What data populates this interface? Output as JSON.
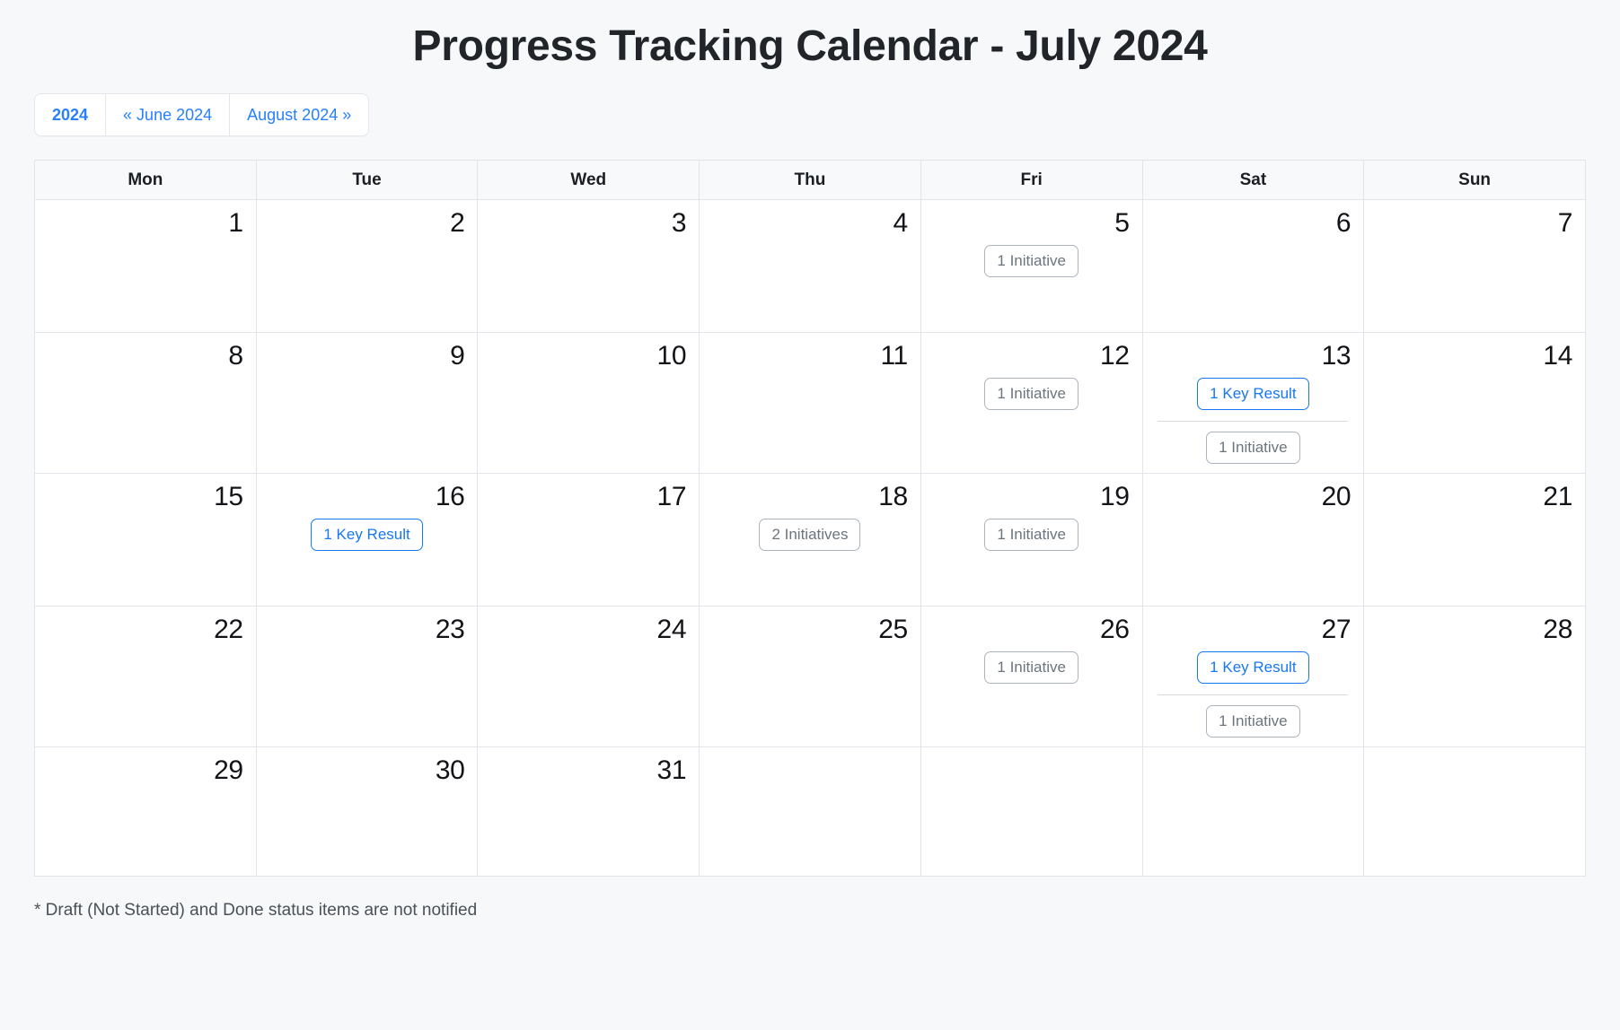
{
  "header": {
    "title": "Progress Tracking Calendar - July 2024"
  },
  "nav": {
    "current_year": "2024",
    "prev_month": "« June 2024",
    "next_month": "August 2024 »"
  },
  "calendar": {
    "weekday_headers": [
      "Mon",
      "Tue",
      "Wed",
      "Thu",
      "Fri",
      "Sat",
      "Sun"
    ],
    "weeks": [
      [
        {
          "day": "1",
          "badges": []
        },
        {
          "day": "2",
          "badges": []
        },
        {
          "day": "3",
          "badges": []
        },
        {
          "day": "4",
          "badges": []
        },
        {
          "day": "5",
          "badges": [
            {
              "label": "1 Initiative",
              "kind": "initiative"
            }
          ]
        },
        {
          "day": "6",
          "badges": []
        },
        {
          "day": "7",
          "badges": []
        }
      ],
      [
        {
          "day": "8",
          "badges": []
        },
        {
          "day": "9",
          "badges": []
        },
        {
          "day": "10",
          "badges": []
        },
        {
          "day": "11",
          "badges": []
        },
        {
          "day": "12",
          "badges": [
            {
              "label": "1 Initiative",
              "kind": "initiative"
            }
          ]
        },
        {
          "day": "13",
          "badges": [
            {
              "label": "1 Key Result",
              "kind": "keyresult"
            },
            {
              "label": "1 Initiative",
              "kind": "initiative"
            }
          ]
        },
        {
          "day": "14",
          "badges": []
        }
      ],
      [
        {
          "day": "15",
          "badges": []
        },
        {
          "day": "16",
          "badges": [
            {
              "label": "1 Key Result",
              "kind": "keyresult"
            }
          ]
        },
        {
          "day": "17",
          "badges": []
        },
        {
          "day": "18",
          "badges": [
            {
              "label": "2 Initiatives",
              "kind": "initiative"
            }
          ]
        },
        {
          "day": "19",
          "badges": [
            {
              "label": "1 Initiative",
              "kind": "initiative"
            }
          ]
        },
        {
          "day": "20",
          "badges": []
        },
        {
          "day": "21",
          "badges": []
        }
      ],
      [
        {
          "day": "22",
          "badges": []
        },
        {
          "day": "23",
          "badges": []
        },
        {
          "day": "24",
          "badges": []
        },
        {
          "day": "25",
          "badges": []
        },
        {
          "day": "26",
          "badges": [
            {
              "label": "1 Initiative",
              "kind": "initiative"
            }
          ]
        },
        {
          "day": "27",
          "badges": [
            {
              "label": "1 Key Result",
              "kind": "keyresult"
            },
            {
              "label": "1 Initiative",
              "kind": "initiative"
            }
          ]
        },
        {
          "day": "28",
          "badges": []
        }
      ],
      [
        {
          "day": "29",
          "badges": []
        },
        {
          "day": "30",
          "badges": []
        },
        {
          "day": "31",
          "badges": []
        },
        {
          "day": "",
          "badges": []
        },
        {
          "day": "",
          "badges": []
        },
        {
          "day": "",
          "badges": []
        },
        {
          "day": "",
          "badges": []
        }
      ]
    ]
  },
  "footer": {
    "note": "* Draft (Not Started) and Done status items are not notified"
  },
  "colors": {
    "page_background": "#f7f8fa",
    "link_blue": "#2680ff",
    "keyresult_blue": "#1877f2",
    "initiative_gray": "#6c757d",
    "grid_border": "#e1e4e8",
    "header_background": "#f8f9fa",
    "title_text": "#212529"
  }
}
